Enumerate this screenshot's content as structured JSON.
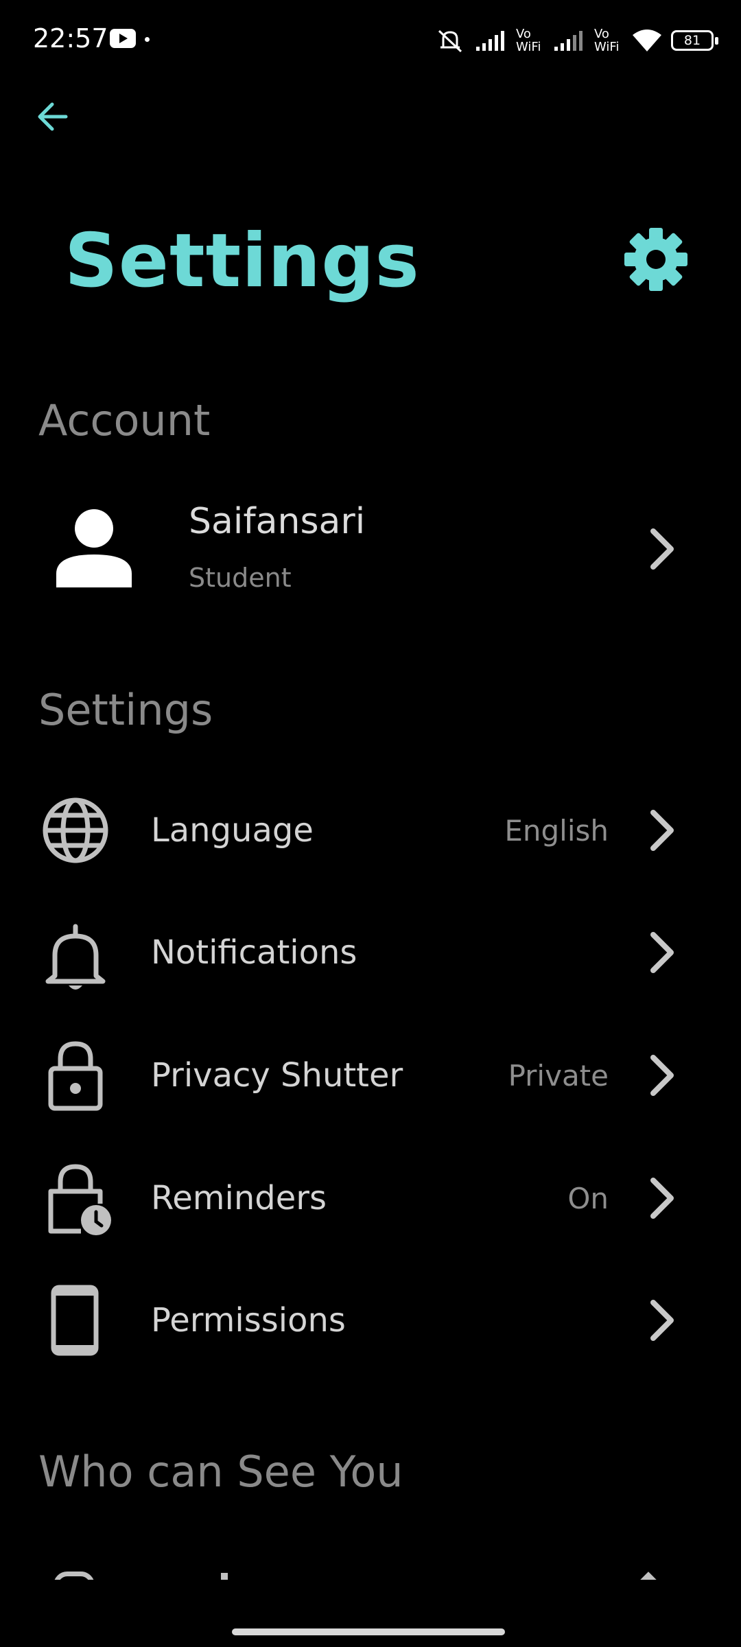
{
  "status_bar": {
    "time": "22:57",
    "vo_wifi_1": "Vo WiFi",
    "vo_wifi_2": "Vo WiFi",
    "battery": "81"
  },
  "header": {
    "back_icon": "arrow-left-icon",
    "title": "Settings",
    "gear_icon": "gear-icon"
  },
  "account_section": {
    "title": "Account",
    "user": {
      "name": "Saifansari",
      "role": "Student"
    }
  },
  "settings_section": {
    "title": "Settings",
    "items": [
      {
        "label": "Language",
        "value": "English",
        "icon": "globe-icon"
      },
      {
        "label": "Notifications",
        "value": "",
        "icon": "bell-icon"
      },
      {
        "label": "Privacy Shutter",
        "value": "Private",
        "icon": "lock-icon"
      },
      {
        "label": "Reminders",
        "value": "On",
        "icon": "lock-clock-icon"
      },
      {
        "label": "Permissions",
        "value": "",
        "icon": "phone-icon"
      }
    ]
  },
  "who_section": {
    "title": "Who can See You"
  },
  "colors": {
    "accent": "#6dd9d6",
    "background": "#000000",
    "text": "#d4d4d4",
    "muted": "#8a8a8a"
  }
}
